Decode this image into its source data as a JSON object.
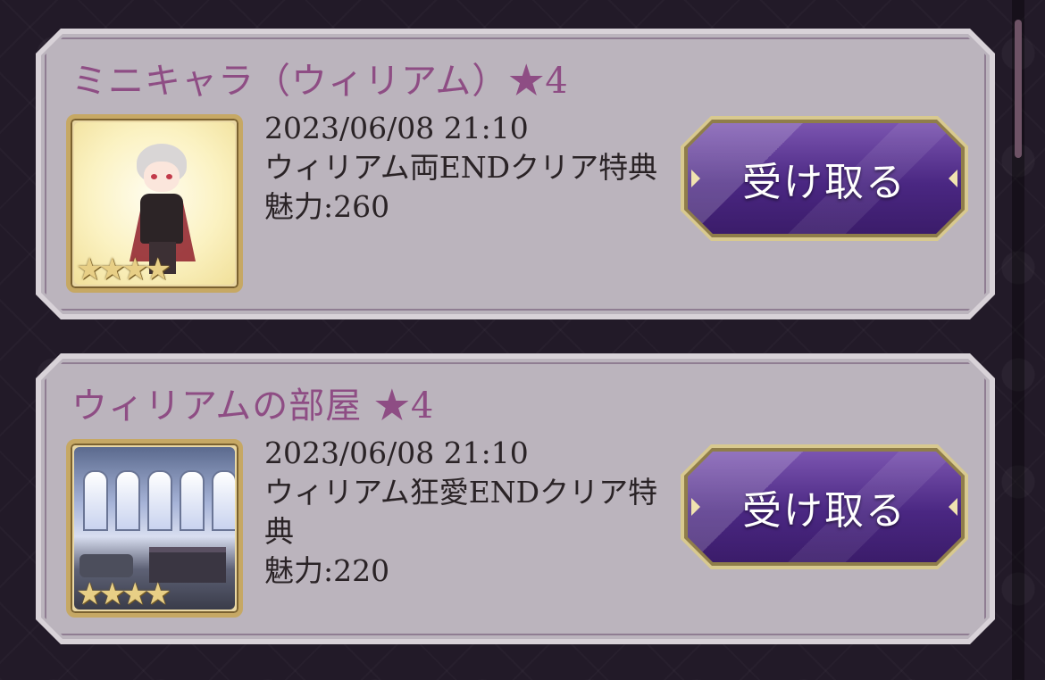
{
  "rewards": [
    {
      "title": "ミニキャラ（ウィリアム）★4",
      "stars": "★★★★",
      "datetime": "2023/06/08 21:10",
      "description": "ウィリアム両ENDクリア特典",
      "charm": "魅力:260",
      "button_label": "受け取る"
    },
    {
      "title": "ウィリアムの部屋 ★4",
      "stars": "★★★★",
      "datetime": "2023/06/08 21:10",
      "description": "ウィリアム狂愛ENDクリア特典",
      "charm": "魅力:220",
      "button_label": "受け取る"
    }
  ],
  "icons": {
    "star": "star-icon",
    "scrollbar": "scrollbar"
  },
  "colors": {
    "title": "#8e4d84",
    "card": "#bbb4bd",
    "button": "#4a2782",
    "gold": "#c6a864",
    "background": "#221a28"
  }
}
